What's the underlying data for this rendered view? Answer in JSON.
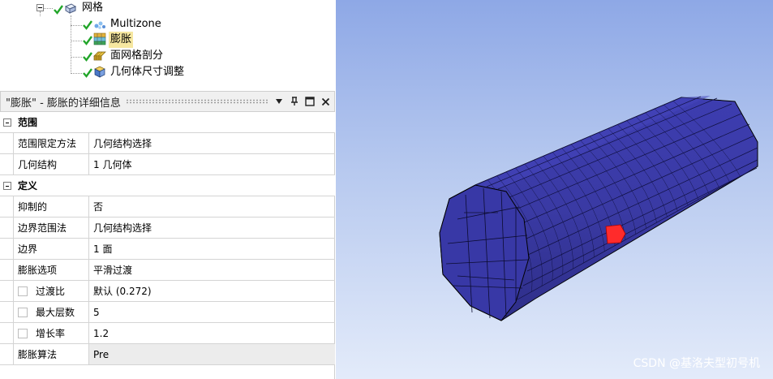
{
  "tree": {
    "root": {
      "label": "网格"
    },
    "children": [
      {
        "label": "Multizone",
        "selected": false
      },
      {
        "label": "膨胀",
        "selected": true
      },
      {
        "label": "面网格剖分",
        "selected": false
      },
      {
        "label": "几何体尺寸调整",
        "selected": false
      }
    ]
  },
  "details": {
    "title": "\"膨胀\" - 膨胀的详细信息",
    "sections": [
      {
        "label": "范围",
        "rows": [
          {
            "key": "范围限定方法",
            "value": "几何结构选择"
          },
          {
            "key": "几何结构",
            "value": "1 几何体"
          }
        ]
      },
      {
        "label": "定义",
        "rows": [
          {
            "key": "抑制的",
            "value": "否"
          },
          {
            "key": "边界范围法",
            "value": "几何结构选择"
          },
          {
            "key": "边界",
            "value": "1 面"
          },
          {
            "key": "膨胀选项",
            "value": "平滑过渡"
          },
          {
            "key": "过渡比",
            "value": "默认 (0.272)",
            "checkbox": true
          },
          {
            "key": "最大层数",
            "value": "5",
            "checkbox": true
          },
          {
            "key": "增长率",
            "value": "1.2",
            "checkbox": true
          },
          {
            "key": "膨胀算法",
            "value": "Pre"
          }
        ]
      }
    ]
  },
  "viewport": {
    "mesh_color": "#3a3aa0",
    "highlight_color": "#ff2b2b",
    "watermark": "CSDN @基洛夫型初号机"
  },
  "colors": {
    "check": "#22a52a",
    "selection": "#f6e7a0"
  }
}
